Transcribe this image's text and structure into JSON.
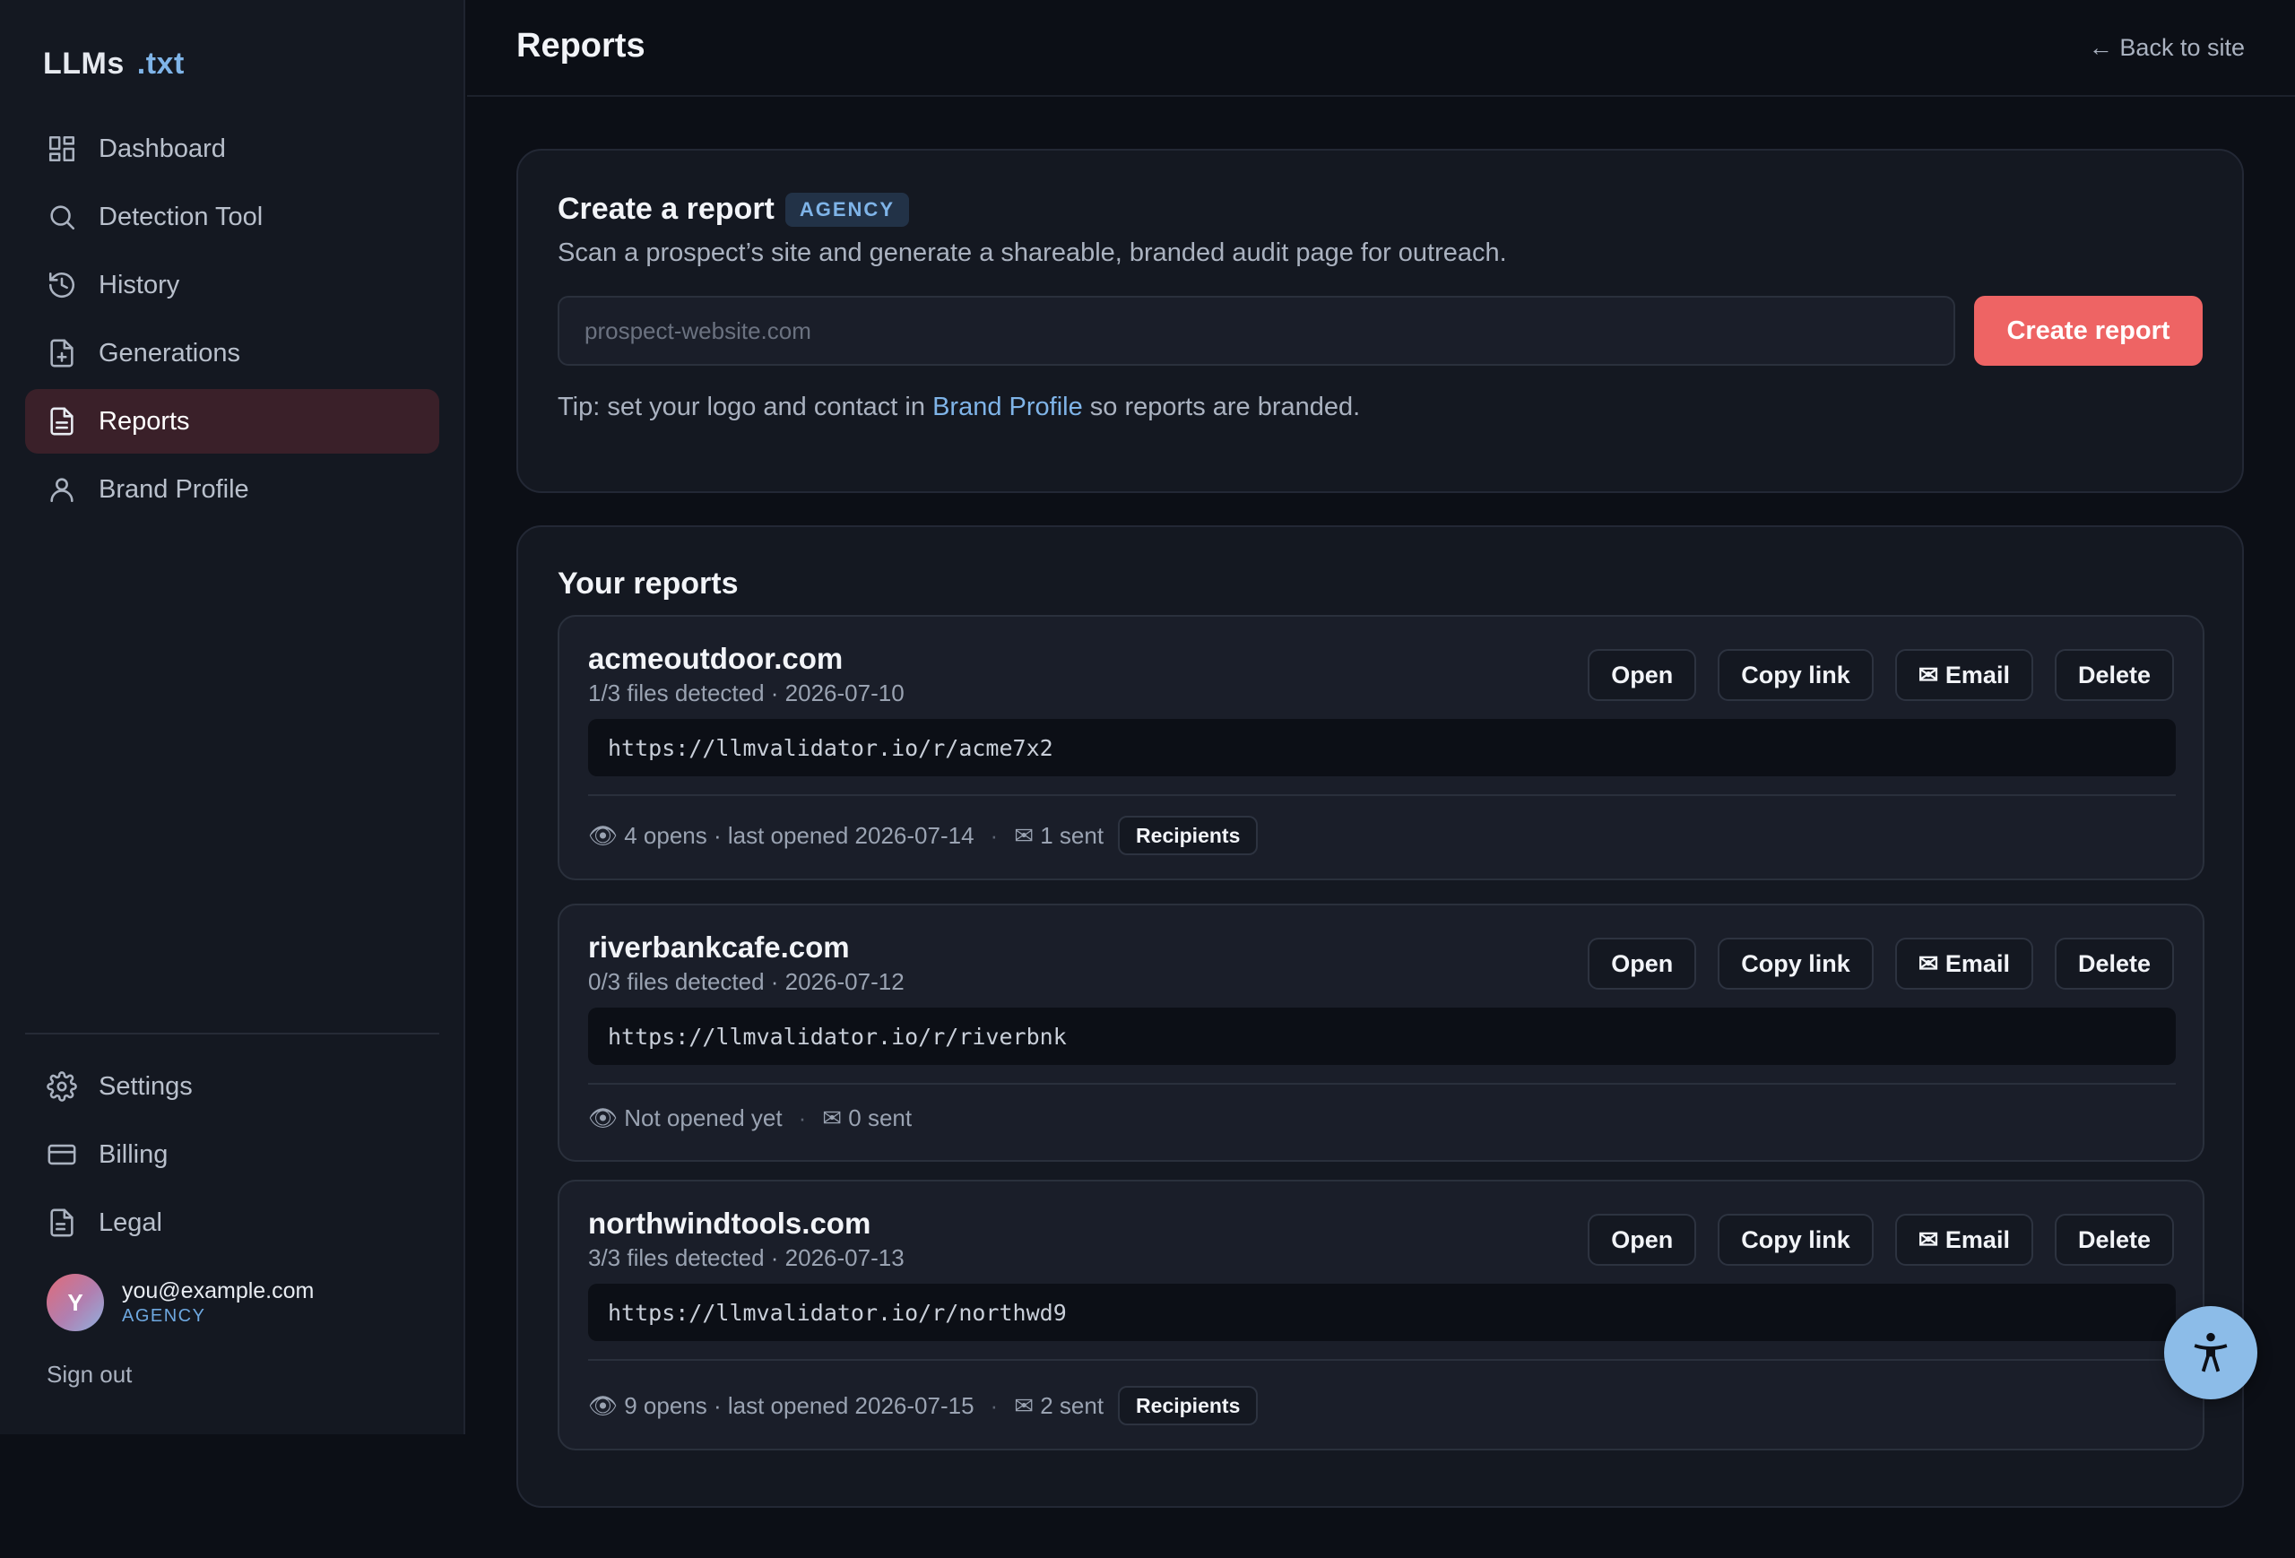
{
  "brand": {
    "name": "LLMs",
    "ext": ".txt"
  },
  "sidebar": {
    "items": [
      {
        "label": "Dashboard",
        "icon": "dashboard-icon"
      },
      {
        "label": "Detection Tool",
        "icon": "search-icon"
      },
      {
        "label": "History",
        "icon": "history-icon"
      },
      {
        "label": "Generations",
        "icon": "file-plus-icon"
      },
      {
        "label": "Reports",
        "icon": "file-text-icon",
        "active": true
      },
      {
        "label": "Brand Profile",
        "icon": "user-icon"
      }
    ],
    "bottom_items": [
      {
        "label": "Settings",
        "icon": "gear-icon"
      },
      {
        "label": "Billing",
        "icon": "credit-card-icon"
      },
      {
        "label": "Legal",
        "icon": "file-icon"
      }
    ],
    "user": {
      "initial": "Y",
      "email": "you@example.com",
      "plan": "AGENCY"
    },
    "sign_out": "Sign out"
  },
  "header": {
    "title": "Reports",
    "back": "← Back to site"
  },
  "create": {
    "title": "Create a report",
    "badge": "AGENCY",
    "description": "Scan a prospect’s site and generate a shareable, branded audit page for outreach.",
    "placeholder": "prospect-website.com",
    "button": "Create report",
    "tip_prefix": "Tip: set your logo and contact in ",
    "tip_link": "Brand Profile",
    "tip_suffix": " so reports are branded."
  },
  "list": {
    "title": "Your reports",
    "actions": {
      "open": "Open",
      "copy": "Copy link",
      "email": "✉ Email",
      "delete": "Delete"
    },
    "recipients_label": "Recipients",
    "reports": [
      {
        "domain": "acmeoutdoor.com",
        "meta": "1/3 files detected · 2026-07-10",
        "url": "https://llmvalidator.io/r/acme7x2",
        "opens": "👁 4 opens · last opened 2026-07-14",
        "sent": "✉ 1 sent"
      },
      {
        "domain": "riverbankcafe.com",
        "meta": "0/3 files detected · 2026-07-12",
        "url": "https://llmvalidator.io/r/riverbnk",
        "opens": "👁 Not opened yet",
        "sent": "✉ 0 sent"
      },
      {
        "domain": "northwindtools.com",
        "meta": "3/3 files detected · 2026-07-13",
        "url": "https://llmvalidator.io/r/northwd9",
        "opens": "👁 9 opens · last opened 2026-07-15",
        "sent": "✉ 2 sent"
      }
    ]
  },
  "fab_icon": "accessibility-icon",
  "colors": {
    "accent": "#ee6464",
    "link": "#7fb4e8",
    "active_nav": "#3a2029"
  }
}
